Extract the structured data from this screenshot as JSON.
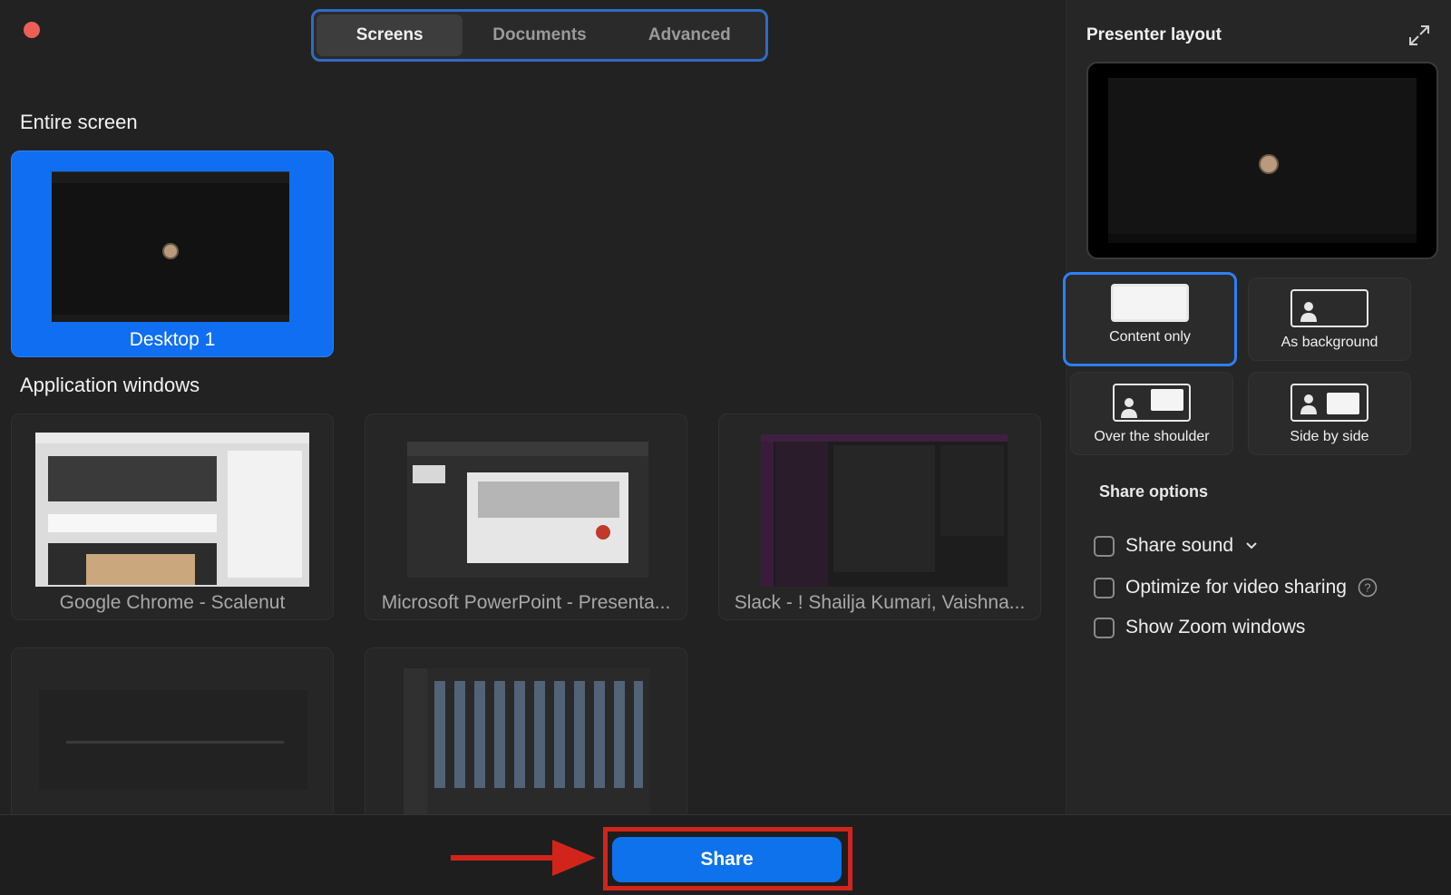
{
  "tabs": [
    {
      "label": "Screens",
      "active": true
    },
    {
      "label": "Documents",
      "active": false
    },
    {
      "label": "Advanced",
      "active": false
    }
  ],
  "entire_screen": {
    "title": "Entire screen",
    "items": [
      {
        "label": "Desktop 1",
        "selected": true
      }
    ]
  },
  "app_windows": {
    "title": "Application windows",
    "items": [
      {
        "label": "Google Chrome - Scalenut"
      },
      {
        "label": "Microsoft PowerPoint - Presenta..."
      },
      {
        "label": "Slack - ! Shailja Kumari, Vaishna..."
      },
      {
        "label": ""
      },
      {
        "label": ""
      }
    ]
  },
  "presenter_layout": {
    "title": "Presenter layout",
    "options": [
      {
        "label": "Content only",
        "selected": true
      },
      {
        "label": "As background",
        "selected": false
      },
      {
        "label": "Over the shoulder",
        "selected": false
      },
      {
        "label": "Side by side",
        "selected": false
      }
    ]
  },
  "share_options": {
    "title": "Share options",
    "items": [
      {
        "label": "Share sound",
        "checked": false
      },
      {
        "label": "Optimize for video sharing",
        "checked": false
      },
      {
        "label": "Show Zoom windows",
        "checked": false
      }
    ]
  },
  "footer": {
    "share_label": "Share"
  },
  "colors": {
    "accent": "#0e72ed",
    "annotation": "#d1251b",
    "close": "#ec5f57"
  },
  "icons": [
    "expand-icon",
    "chevron-down-icon",
    "help-icon",
    "person-icon",
    "arrow-icon"
  ]
}
